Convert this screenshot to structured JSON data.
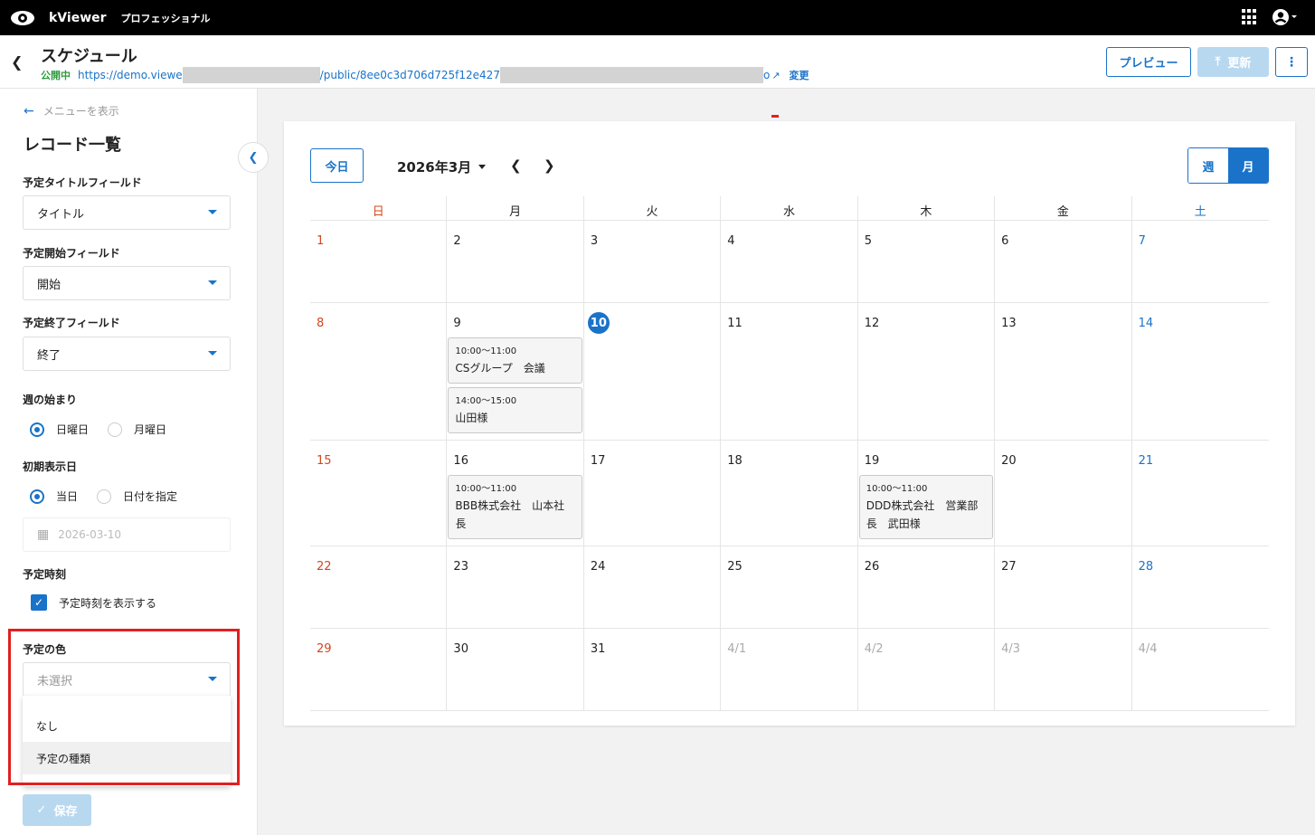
{
  "topbar": {
    "app_name": "kViewer",
    "edition": "プロフェッショナル"
  },
  "header": {
    "title": "スケジュール",
    "status": "公開中",
    "url_prefix": "https://demo.viewe",
    "url_middle": "/public/8ee0c3d706d725f12e427",
    "url_suffix": "o",
    "change": "変更",
    "preview": "プレビュー",
    "update": "更新"
  },
  "sidebar": {
    "menu_show": "メニューを表示",
    "title": "レコード一覧",
    "title_field_label": "予定タイトルフィールド",
    "title_field_value": "タイトル",
    "start_field_label": "予定開始フィールド",
    "start_field_value": "開始",
    "end_field_label": "予定終了フィールド",
    "end_field_value": "終了",
    "week_start_label": "週の始まり",
    "week_start_options": [
      "日曜日",
      "月曜日"
    ],
    "initial_date_label": "初期表示日",
    "initial_date_options": [
      "当日",
      "日付を指定"
    ],
    "date_placeholder": "2026-03-10",
    "event_time_label": "予定時刻",
    "event_time_check": "予定時刻を表示する",
    "color_label": "予定の色",
    "color_placeholder": "未選択",
    "color_options": [
      "なし",
      "予定の種類"
    ],
    "save": "保存"
  },
  "calendar": {
    "today": "今日",
    "month": "2026年3月",
    "view_week": "週",
    "view_month": "月",
    "weekdays": [
      "日",
      "月",
      "火",
      "水",
      "木",
      "金",
      "土"
    ],
    "weeks": [
      [
        "1",
        "2",
        "3",
        "4",
        "5",
        "6",
        "7"
      ],
      [
        "8",
        "9",
        "10",
        "11",
        "12",
        "13",
        "14"
      ],
      [
        "15",
        "16",
        "17",
        "18",
        "19",
        "20",
        "21"
      ],
      [
        "22",
        "23",
        "24",
        "25",
        "26",
        "27",
        "28"
      ],
      [
        "29",
        "30",
        "31",
        "4/1",
        "4/2",
        "4/3",
        "4/4"
      ]
    ],
    "events": {
      "e1_time": "10:00〜11:00",
      "e1_title": "CSグループ　会議",
      "e2_time": "14:00〜15:00",
      "e2_title": "山田様",
      "e3_time": "10:00〜11:00",
      "e3_title": "BBB株式会社　山本社長",
      "e4_time": "10:00〜11:00",
      "e4_title": "DDD株式会社　営業部長　武田様"
    }
  },
  "colors": {
    "accent": "#1a73c9",
    "sunday": "#d2461d",
    "highlight": "#e02020"
  }
}
